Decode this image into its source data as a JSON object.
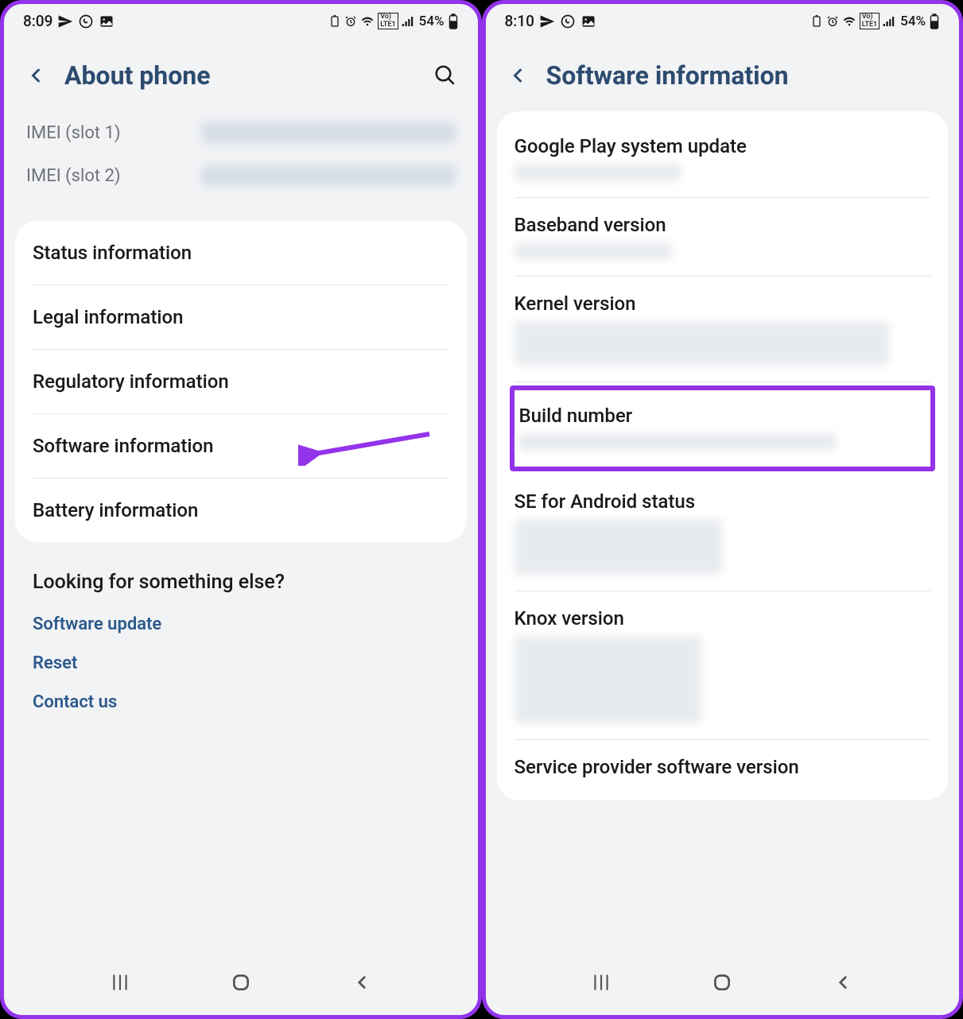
{
  "screen1": {
    "status": {
      "time": "8:09",
      "battery": "54%"
    },
    "title": "About phone",
    "imei": [
      {
        "label": "IMEI (slot 1)"
      },
      {
        "label": "IMEI (slot 2)"
      }
    ],
    "items": [
      {
        "label": "Status information"
      },
      {
        "label": "Legal information"
      },
      {
        "label": "Regulatory information"
      },
      {
        "label": "Software information"
      },
      {
        "label": "Battery information"
      }
    ],
    "looking": {
      "title": "Looking for something else?",
      "links": [
        {
          "label": "Software update"
        },
        {
          "label": "Reset"
        },
        {
          "label": "Contact us"
        }
      ]
    }
  },
  "screen2": {
    "status": {
      "time": "8:10",
      "battery": "54%"
    },
    "title": "Software information",
    "items": [
      {
        "label": "Google Play system update"
      },
      {
        "label": "Baseband version"
      },
      {
        "label": "Kernel version"
      },
      {
        "label": "Build number",
        "highlight": true
      },
      {
        "label": "SE for Android status"
      },
      {
        "label": "Knox version"
      },
      {
        "label": "Service provider software version"
      }
    ]
  },
  "annotation": {
    "color": "#9333ea"
  }
}
